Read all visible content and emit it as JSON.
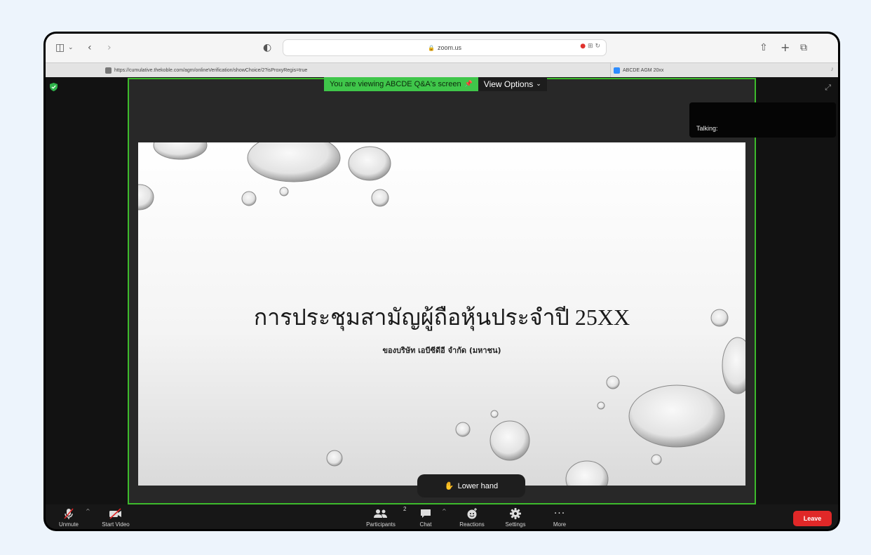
{
  "browser": {
    "address": "zoom.us",
    "tabs": [
      {
        "label": "https://cumulative.thekoble.com/agm/onlineVerification/showChoice/2?isProxyRegis=true"
      },
      {
        "label": "ABCDE AGM 20xx"
      }
    ]
  },
  "meeting": {
    "viewing_banner": "You are viewing ABCDE Q&A's screen",
    "view_options": "View Options",
    "talking_label": "Talking:",
    "lower_hand": "Lower hand",
    "participants_count": "2"
  },
  "slide": {
    "title": "การประชุมสามัญผู้ถือหุ้นประจำปี 25XX",
    "subtitle": "ของบริษัท เอบีซีดีอี จำกัด (มหาชน)"
  },
  "controls": {
    "unmute": "Unmute",
    "start_video": "Start Video",
    "participants": "Participants",
    "chat": "Chat",
    "reactions": "Reactions",
    "settings": "Settings",
    "more": "More",
    "leave": "Leave"
  },
  "colors": {
    "share_border": "#3dbb2c",
    "banner_green": "#3fc64a",
    "leave_red": "#e02828",
    "background": "#edf4fc"
  }
}
